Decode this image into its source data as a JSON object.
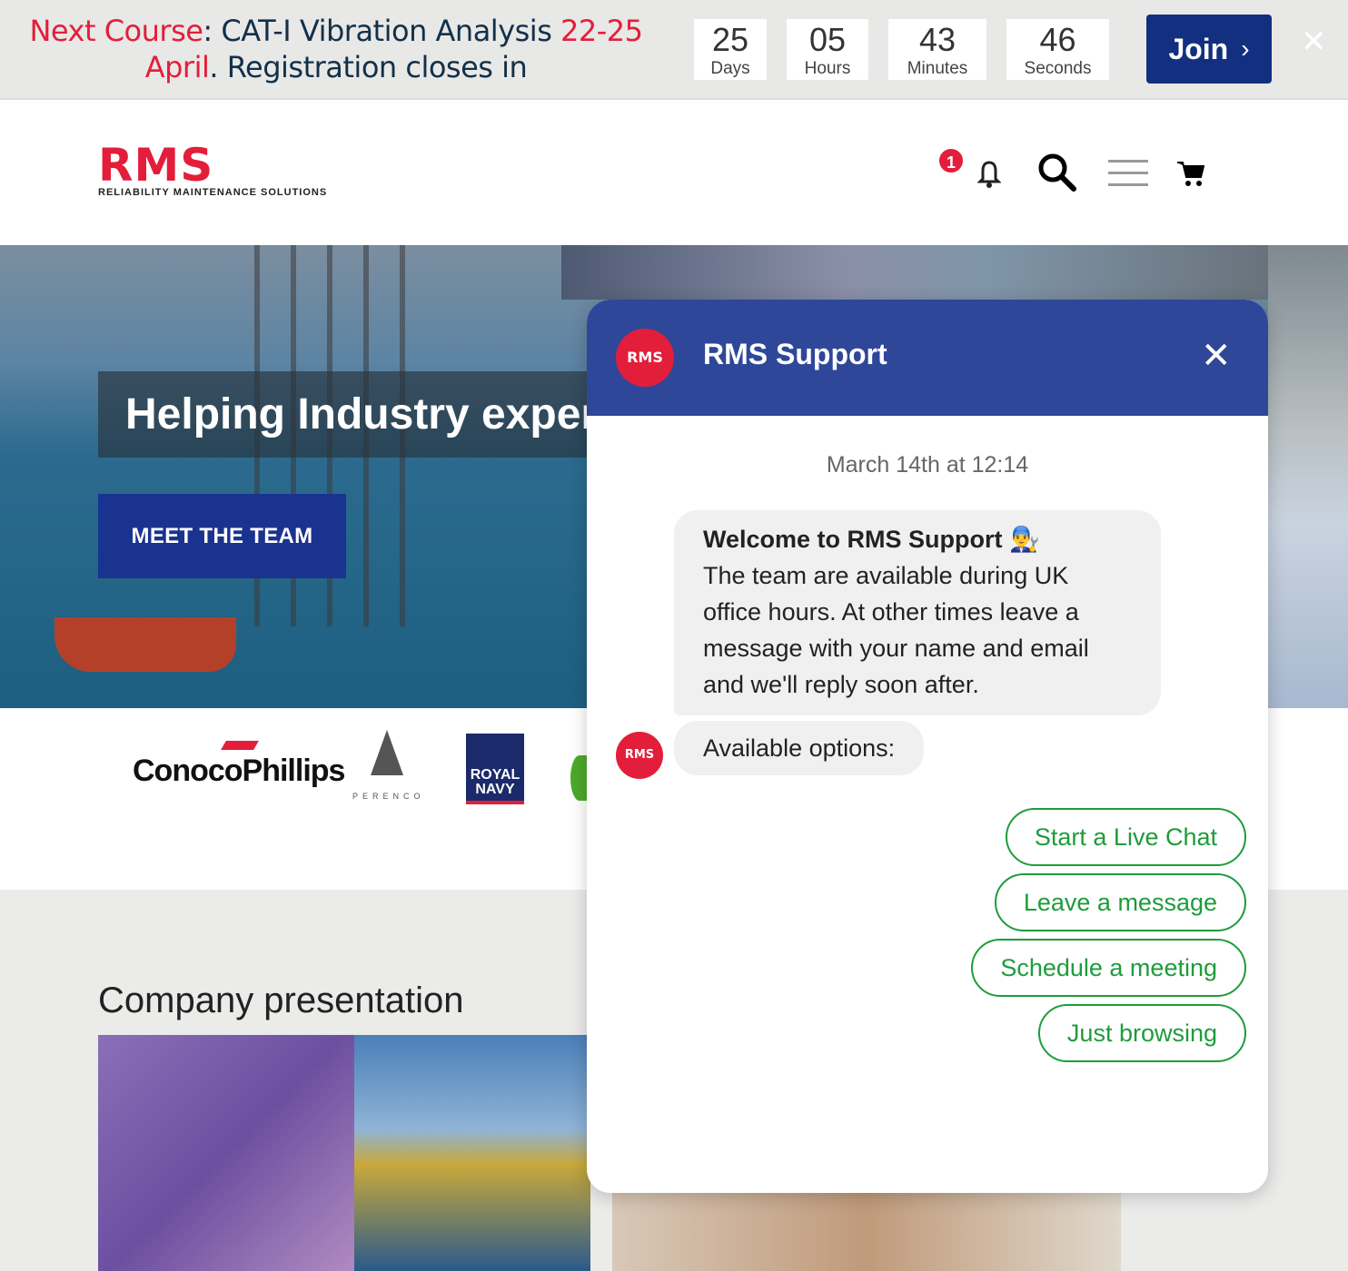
{
  "promo": {
    "part1": "Next Course",
    "part2": ": CAT-I Vibration Analysis ",
    "part3": "22-25",
    "part4": "April",
    "part5": ". Registration closes in"
  },
  "countdown": [
    {
      "value": "25",
      "label": "Days"
    },
    {
      "value": "05",
      "label": "Hours"
    },
    {
      "value": "43",
      "label": "Minutes"
    },
    {
      "value": "46",
      "label": "Seconds"
    }
  ],
  "join_label": "Join",
  "logo": {
    "name": "RMS",
    "tagline": "RELIABILITY MAINTENANCE SOLUTIONS"
  },
  "header": {
    "notification_count": "1",
    "icons": [
      "bell-icon",
      "search-icon",
      "menu-icon",
      "cart-icon"
    ]
  },
  "hero": {
    "title": "Helping Industry exper",
    "button": "MEET THE TEAM"
  },
  "client_logos": [
    "ConocoPhillips",
    "PERENCO",
    "ROYAL NAVY",
    "bp"
  ],
  "section_title": "Company presentation",
  "chat": {
    "avatar": "RMS",
    "title": "RMS Support",
    "timestamp": "March 14th at 12:14",
    "welcome_title": "Welcome to RMS Support 👨‍🔧",
    "welcome_body": "The team are available during UK office hours. At other times leave a message with your name and email and we'll reply soon after.",
    "options_label": "Available options:",
    "options": [
      "Start a Live Chat",
      "Leave a message",
      "Schedule a meeting",
      "Just browsing"
    ],
    "accent": "#2f4799",
    "option_color": "#1e9c3c"
  },
  "colors": {
    "brand_red": "#e31e3a",
    "brand_blue": "#12307f"
  }
}
